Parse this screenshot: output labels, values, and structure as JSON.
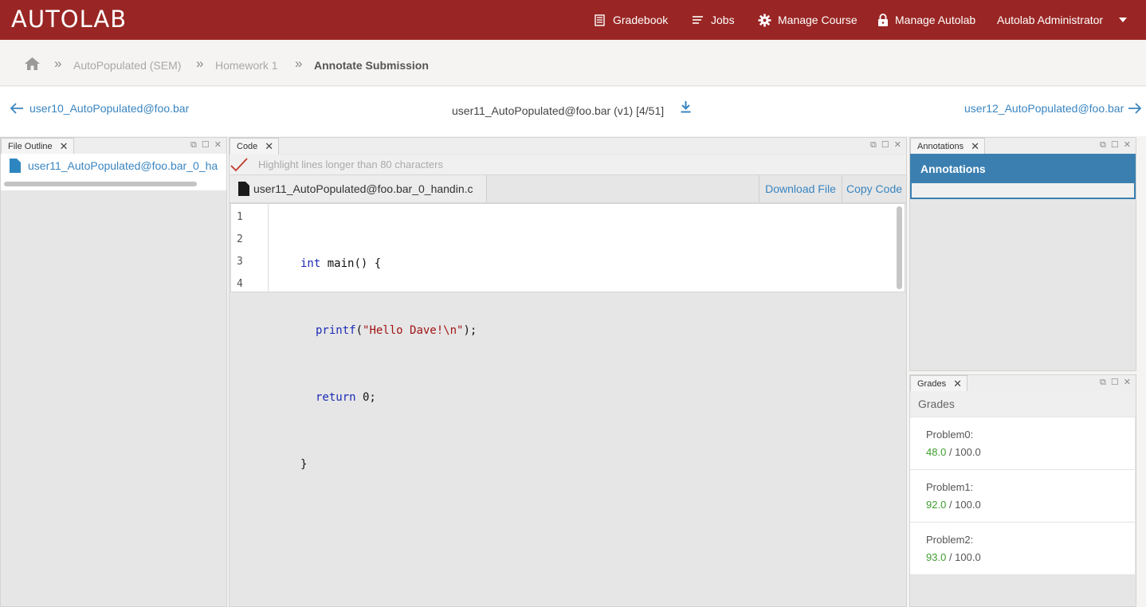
{
  "topnav": {
    "logo": "AUTOLAB",
    "items": [
      {
        "label": "Gradebook",
        "icon": "gradebook-icon"
      },
      {
        "label": "Jobs",
        "icon": "jobs-icon"
      },
      {
        "label": "Manage Course",
        "icon": "gear-icon"
      },
      {
        "label": "Manage Autolab",
        "icon": "lock-icon"
      },
      {
        "label": "Autolab Administrator",
        "icon": "caret-down-icon"
      }
    ]
  },
  "breadcrumb": {
    "items": [
      "AutoPopulated (SEM)",
      "Homework 1",
      "Annotate Submission"
    ],
    "separator": "»"
  },
  "subhead": {
    "prev_user": "user10_AutoPopulated@foo.bar",
    "current": "user11_AutoPopulated@foo.bar (v1) [4/51]",
    "next_user": "user12_AutoPopulated@foo.bar"
  },
  "file_outline": {
    "tab": "File Outline",
    "file": "user11_AutoPopulated@foo.bar_0_ha"
  },
  "code_panel": {
    "tab": "Code",
    "highlight_label": "Highlight lines longer than 80 characters",
    "filename": "user11_AutoPopulated@foo.bar_0_handin.c",
    "download_label": "Download File",
    "copy_label": "Copy Code",
    "line_numbers": [
      "1",
      "2",
      "3",
      "4"
    ],
    "lines": [
      {
        "kw": "int",
        "rest": " main() {"
      },
      {
        "kw": "printf",
        "str": "\"Hello Dave!\\n\"",
        "pre": "(",
        "post": ");"
      },
      {
        "kw": "return",
        "rest": " 0;"
      },
      {
        "rest": "}"
      }
    ]
  },
  "annotations_panel": {
    "tab": "Annotations",
    "header": "Annotations"
  },
  "grades_panel": {
    "tab": "Grades",
    "header": "Grades",
    "problems": [
      {
        "name": "Problem0:",
        "score": "48.0",
        "max": "/ 100.0"
      },
      {
        "name": "Problem1:",
        "score": "92.0",
        "max": "/ 100.0"
      },
      {
        "name": "Problem2:",
        "score": "93.0",
        "max": "/ 100.0"
      }
    ]
  },
  "colors": {
    "brand": "#992624",
    "link": "#3a85c0",
    "annotations_header": "#3b7fb0",
    "score": "#3f9d2e"
  }
}
